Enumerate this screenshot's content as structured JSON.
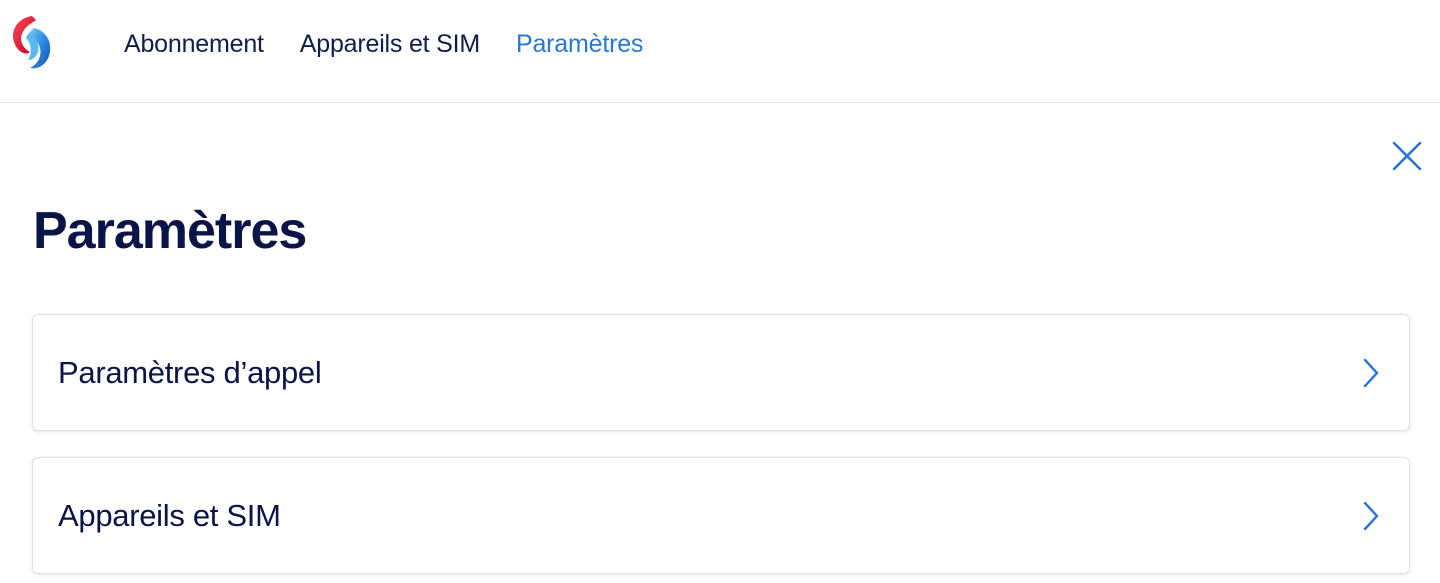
{
  "header": {
    "logo_icon": "swisscom-logo-icon",
    "nav": [
      {
        "label": "Abonnement",
        "active": false
      },
      {
        "label": "Appareils et SIM",
        "active": false
      },
      {
        "label": "Paramètres",
        "active": true
      }
    ]
  },
  "main": {
    "close_icon": "close-icon",
    "title": "Paramètres",
    "cards": [
      {
        "label": "Paramètres d’appel",
        "icon": "chevron-right-icon"
      },
      {
        "label": "Appareils et SIM",
        "icon": "chevron-right-icon"
      }
    ]
  },
  "colors": {
    "text_dark": "#0a1446",
    "accent": "#2a77d3",
    "logo_red": "#e0142d",
    "logo_blue": "#2a77d3"
  }
}
